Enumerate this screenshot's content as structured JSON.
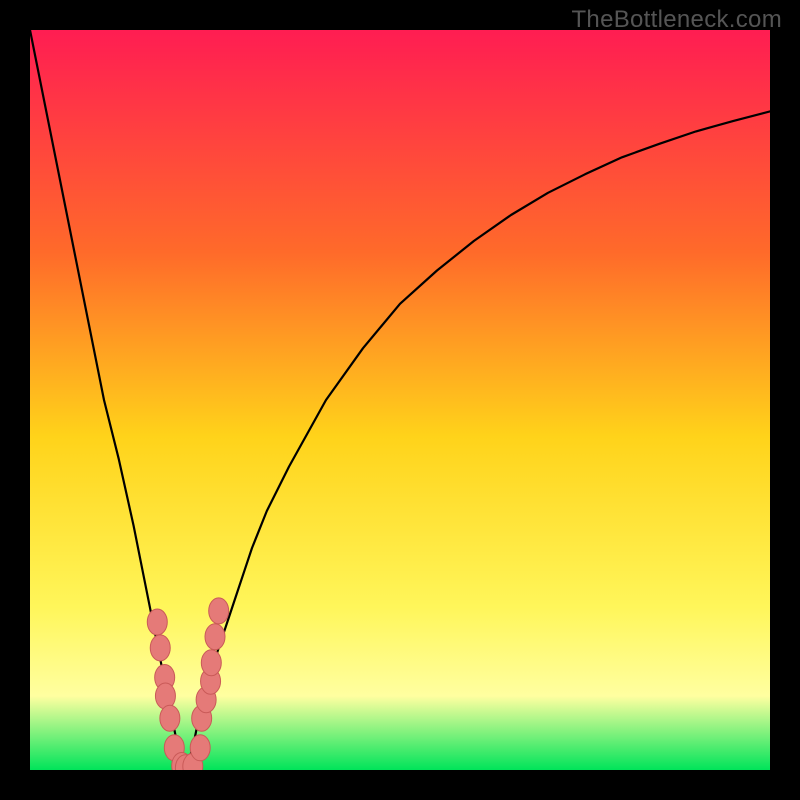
{
  "watermark": "TheBottleneck.com",
  "colors": {
    "top": "#ff1d52",
    "upper_mid": "#ff6a2a",
    "mid": "#ffd31a",
    "lower_mid": "#fff65a",
    "haze": "#ffffa0",
    "bottom": "#00e45a",
    "curve": "#000000",
    "dots_fill": "#e57a78",
    "dots_stroke": "#c95a58",
    "frame": "#000000"
  },
  "chart_data": {
    "type": "line",
    "title": "",
    "xlabel": "",
    "ylabel": "",
    "xlim": [
      0,
      100
    ],
    "ylim": [
      0,
      100
    ],
    "x": [
      0,
      2,
      4,
      6,
      8,
      10,
      12,
      14,
      15,
      16,
      17,
      18,
      19,
      20,
      21,
      22,
      23,
      24,
      25,
      26,
      27,
      28,
      29,
      30,
      32,
      35,
      40,
      45,
      50,
      55,
      60,
      65,
      70,
      75,
      80,
      85,
      90,
      95,
      100
    ],
    "values": [
      100,
      90,
      80,
      70,
      60,
      50,
      42,
      33,
      28,
      23,
      18,
      13,
      8,
      3,
      0,
      3,
      8,
      12,
      15,
      18,
      21,
      24,
      27,
      30,
      35,
      41,
      50,
      57,
      63,
      67.5,
      71.5,
      75,
      78,
      80.5,
      82.8,
      84.6,
      86.3,
      87.7,
      89
    ],
    "dots": [
      {
        "x": 17.2,
        "y": 20.0
      },
      {
        "x": 17.6,
        "y": 16.5
      },
      {
        "x": 18.2,
        "y": 12.5
      },
      {
        "x": 18.3,
        "y": 10.0
      },
      {
        "x": 18.9,
        "y": 7.0
      },
      {
        "x": 19.5,
        "y": 3.0
      },
      {
        "x": 20.5,
        "y": 0.6
      },
      {
        "x": 21.0,
        "y": 0.3
      },
      {
        "x": 22.0,
        "y": 0.5
      },
      {
        "x": 23.0,
        "y": 3.0
      },
      {
        "x": 23.2,
        "y": 7.0
      },
      {
        "x": 23.8,
        "y": 9.5
      },
      {
        "x": 24.4,
        "y": 12.0
      },
      {
        "x": 24.5,
        "y": 14.5
      },
      {
        "x": 25.0,
        "y": 18.0
      },
      {
        "x": 25.5,
        "y": 21.5
      }
    ]
  }
}
